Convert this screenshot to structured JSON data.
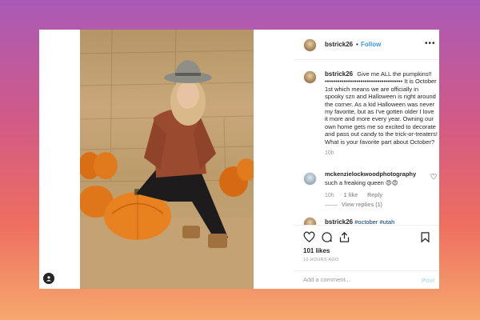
{
  "post": {
    "username": "bstrick26",
    "separator": "•",
    "follow_label": "Follow",
    "more_label": "•••",
    "caption": {
      "username": "bstrick26",
      "text": "Give me ALL the pumpkins!! ••••••••••••••••••••••••••••••••••••• It is October 1st which means we are officially in spooky szn and Halloween is right around the corner. As a kid Halloween was never my favorite, but as I've gotten older I love it more and more every year. Owning our own home gets me so excited to decorate and pass out candy to the trick-or-treaters! What is your favorite part about October?",
      "time": "10h"
    },
    "comments": [
      {
        "username": "mckenzielockwoodphotography",
        "text": "such a freaking queen 😍😍",
        "time": "10h",
        "likes": "1 like",
        "reply_label": "Reply",
        "view_replies": "View replies (1)"
      }
    ],
    "partial_comment": {
      "username": "bstrick26",
      "text": "#october #utah"
    },
    "likes": "101 likes",
    "time_ago": "10 HOURS AGO",
    "add_comment": {
      "placeholder": "Add a comment...",
      "post_label": "Post"
    }
  },
  "colors": {
    "accent_blue": "#3897f0",
    "post_button_disabled": "#b2dffc",
    "text_primary": "#262626",
    "text_secondary": "#999999",
    "background_gradient_top": "#a95ab8",
    "background_gradient_bottom": "#f6a86d"
  },
  "icons": [
    "user-tag-icon",
    "more-icon",
    "heart-icon",
    "comment-icon",
    "share-icon",
    "bookmark-icon",
    "heart-small-icon"
  ]
}
